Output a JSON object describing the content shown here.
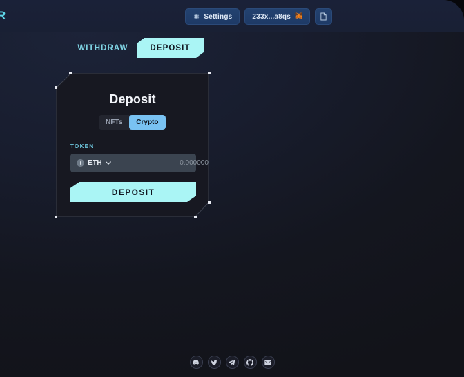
{
  "window": {
    "background_gradient_from": "#1c2338",
    "background_gradient_to": "#121319"
  },
  "header": {
    "logo_text": "R",
    "logo_color": "#5fd7e8",
    "settings_button": {
      "label": "Settings",
      "icon": "gear-icon"
    },
    "wallet_button": {
      "label": "233x...a8qs",
      "icon": "metamask-fox-icon"
    },
    "copy_button": {
      "label": "",
      "icon": "document-copy-icon"
    },
    "accent_button_color": "#234270"
  },
  "tabs": {
    "items": [
      {
        "id": "withdraw",
        "label": "WITHDRAW",
        "active": false
      },
      {
        "id": "deposit",
        "label": "DEPOSIT",
        "active": true
      }
    ],
    "active_color": "#aaf5f5",
    "inactive_color": "#7fd4e4"
  },
  "card": {
    "title": "Deposit",
    "segmented": {
      "options": [
        {
          "id": "nfts",
          "label": "NFTs",
          "active": false
        },
        {
          "id": "crypto",
          "label": "Crypto",
          "active": true
        }
      ],
      "active_color": "#79c2f2"
    },
    "token": {
      "label": "TOKEN",
      "label_color": "#6ec7de",
      "selected_symbol": "ETH",
      "selected_icon": "ethereum-icon",
      "dropdown_icon": "chevron-down-icon",
      "amount_value": "",
      "amount_placeholder": "0.000000"
    },
    "cta": {
      "label": "DEPOSIT",
      "color": "#aaf5f5"
    }
  },
  "footer": {
    "socials": [
      {
        "id": "discord",
        "icon": "discord-icon",
        "label": "Discord"
      },
      {
        "id": "twitter",
        "icon": "twitter-icon",
        "label": "Twitter"
      },
      {
        "id": "telegram",
        "icon": "telegram-icon",
        "label": "Telegram"
      },
      {
        "id": "github",
        "icon": "github-icon",
        "label": "GitHub"
      },
      {
        "id": "email",
        "icon": "email-icon",
        "label": "Email"
      }
    ]
  }
}
